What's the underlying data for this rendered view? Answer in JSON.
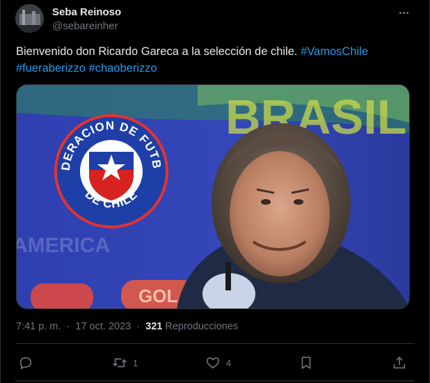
{
  "author": {
    "display_name": "Seba Reinoso",
    "handle": "@sebareinher"
  },
  "tweet": {
    "text": "Bienvenido don Ricardo Gareca a la selección de chile.",
    "hashtags": [
      "#VamosChile",
      "#fueraberizzo",
      "#chaoberizzo"
    ],
    "time": "7:41 p. m.",
    "separator": "·",
    "date": "17 oct. 2023",
    "views_count": "321",
    "views_label": "Reproducciones"
  },
  "media": {
    "logo_top_text": "FEDERACION DE FUTBOL",
    "logo_bottom_text": "DE CHILE",
    "background_left_text": "AMERICA",
    "background_top_text": "BRASIL",
    "background_bottom_text": "GOL"
  },
  "actions": {
    "reply": {
      "icon": "reply-icon",
      "count": ""
    },
    "retweet": {
      "icon": "retweet-icon",
      "count": "1"
    },
    "like": {
      "icon": "heart-icon",
      "count": "4"
    },
    "bookmark": {
      "icon": "bookmark-icon",
      "count": ""
    },
    "share": {
      "icon": "share-icon",
      "count": ""
    }
  },
  "colors": {
    "background": "#000000",
    "text": "#e7e9ea",
    "secondary": "#71767b",
    "link": "#1d9bf0",
    "border": "#2f3336"
  }
}
